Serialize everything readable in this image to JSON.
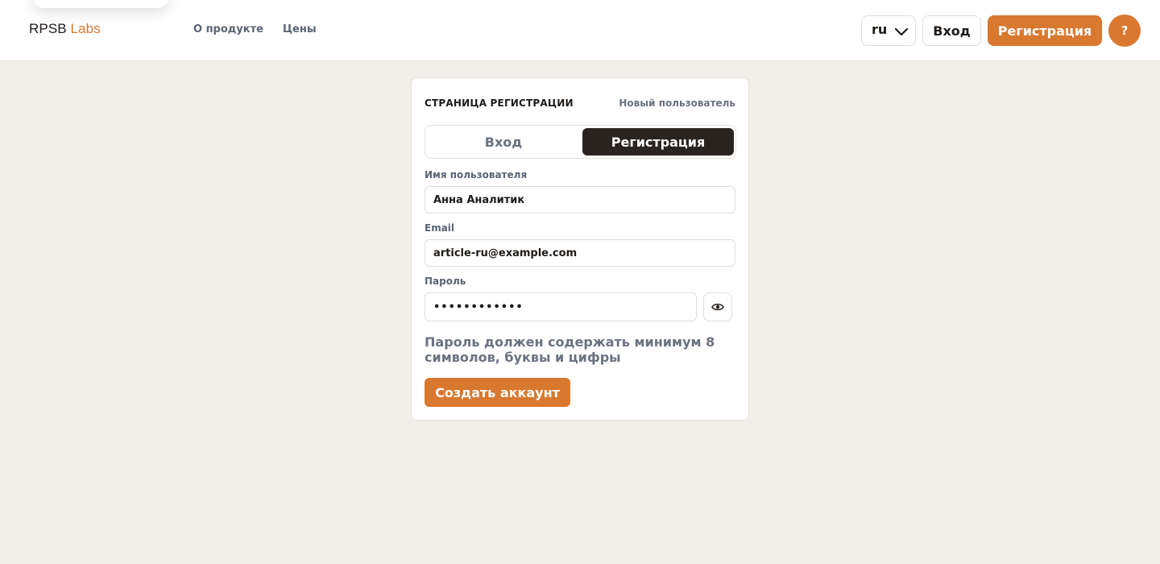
{
  "header": {
    "brand_part1": "RPSB",
    "brand_part2": "Labs",
    "nav": [
      {
        "label": "О продукте"
      },
      {
        "label": "Цены"
      }
    ],
    "language": "ru",
    "login_label": "Вход",
    "register_label": "Регистрация",
    "help_label": "?"
  },
  "card": {
    "title": "СТРАНИЦА РЕГИСТРАЦИИ",
    "subtitle": "Новый пользователь",
    "tabs": [
      {
        "label": "Вход",
        "active": false
      },
      {
        "label": "Регистрация",
        "active": true
      }
    ],
    "fields": {
      "username": {
        "label": "Имя пользователя",
        "value": "Анна Аналитик"
      },
      "email": {
        "label": "Email",
        "value": "article-ru@example.com"
      },
      "password": {
        "label": "Пароль",
        "value": "••••••••••••"
      }
    },
    "password_hint": "Пароль должен содержать минимум 8 символов, буквы и цифры",
    "submit_label": "Создать аккаунт"
  },
  "icons": {
    "language_chevron": "chevron-down-icon",
    "password_toggle": "eye-icon"
  },
  "colors": {
    "accent": "#d9782f",
    "background": "#f2efea",
    "active_tab": "#2a2421"
  }
}
